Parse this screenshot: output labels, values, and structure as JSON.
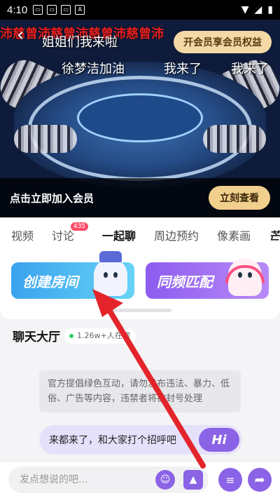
{
  "status_bar": {
    "time": "4:10"
  },
  "video": {
    "danmaku_top": "沛慈曾沛慈曾沛慈曾沛慈曾沛",
    "danmaku_line1": "姐姐们我来啦",
    "danmaku_line2a": "徐梦洁加油",
    "danmaku_line2b": "我来了",
    "danmaku_line2c": "我来了",
    "vip_label": "开会员享会员权益",
    "join_text": "点击立即加入会员",
    "join_button": "立刻查看"
  },
  "tabs": [
    {
      "label": "视频"
    },
    {
      "label": "讨论",
      "badge": "435"
    },
    {
      "label": "一起聊"
    },
    {
      "label": "周边预约"
    },
    {
      "label": "像素画"
    },
    {
      "label": "芒推"
    }
  ],
  "cards": {
    "create": "创建房间",
    "match": "同频匹配"
  },
  "hall": {
    "title": "聊天大厅",
    "online": "1.26w+人在聊",
    "notice": "官方提倡绿色互动，请勿发布违法、暴力、低俗、广告等内容，违禁者将被封号处理",
    "greet": "来都来了，和大家打个招呼吧",
    "hi": "Hi"
  },
  "input": {
    "placeholder": "发点想说的吧..."
  },
  "colors": {
    "accent": "#8a63e6",
    "gold": "#f1cf8c",
    "annotation_arrow": "#e3252b"
  }
}
